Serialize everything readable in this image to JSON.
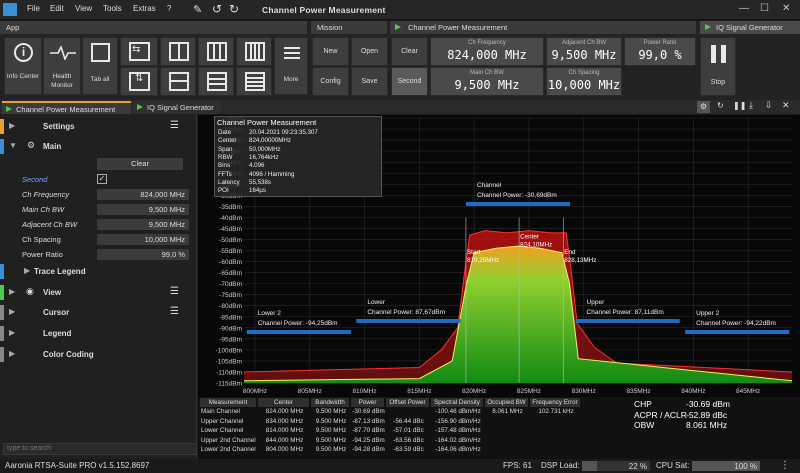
{
  "menu": {
    "file": "File",
    "edit": "Edit",
    "view": "View",
    "tools": "Tools",
    "extras": "Extras",
    "help": "?"
  },
  "window_title": "Channel Power Measurement",
  "groups": {
    "app": "App",
    "mission": "Mission",
    "channel": "Channel Power Measurement",
    "iq": "IQ Signal Generator"
  },
  "buttons": {
    "info_center": "Info Center",
    "health_monitor": "Health Monitor",
    "tab_all": "Tab all",
    "more": "More",
    "new": "New",
    "open": "Open",
    "config": "Config",
    "save": "Save",
    "clear": "Clear",
    "second": "Second",
    "stop": "Stop"
  },
  "fields": {
    "ch_frequency": {
      "label": "Ch Frequency",
      "value": "824,000 MHz"
    },
    "adjacent_ch_bw": {
      "label": "Adjacent Ch BW",
      "value": "9,500 MHz"
    },
    "power_ratio": {
      "label": "Power Ratio",
      "value": "99,0 %"
    },
    "main_ch_bw": {
      "label": "Main Ch BW",
      "value": "9,500 MHz"
    },
    "ch_spacing": {
      "label": "Ch Spacing",
      "value": "10,000 MHz"
    }
  },
  "tabs": {
    "channel": "Channel Power Measurement",
    "iq": "IQ Signal Generator"
  },
  "panel": {
    "settings": "Settings",
    "main": "Main",
    "clear": "Clear",
    "rows": [
      {
        "label": "Second",
        "value": ""
      },
      {
        "label": "Ch Frequency",
        "value": "824,000 MHz"
      },
      {
        "label": "Main Ch BW",
        "value": "9,500 MHz"
      },
      {
        "label": "Adjacent Ch BW",
        "value": "9,500 MHz"
      },
      {
        "label": "Ch Spacing",
        "value": "10,000 MHz"
      },
      {
        "label": "Power Ratio",
        "value": "99,0 %"
      }
    ],
    "trace_legend": "Trace Legend",
    "view": "View",
    "cursor": "Cursor",
    "legend": "Legend",
    "color_coding": "Color Coding",
    "search_placeholder": "type to search"
  },
  "chart_data": {
    "type": "line",
    "xlabel": "",
    "ylabel": "",
    "x_ticks": [
      "800MHz",
      "805MHz",
      "810MHz",
      "815MHz",
      "820MHz",
      "825MHz",
      "830MHz",
      "835MHz",
      "840MHz",
      "845MHz"
    ],
    "y_ticks": [
      "5dBm",
      "0dBm",
      "-5dBm",
      "-10dBm",
      "-15dBm",
      "-20dBm",
      "-25dBm",
      "-30dBm",
      "-35dBm",
      "-40dBm",
      "-45dBm",
      "-50dBm",
      "-55dBm",
      "-60dBm",
      "-65dBm",
      "-70dBm",
      "-75dBm",
      "-80dBm",
      "-85dBm",
      "-90dBm",
      "-95dBm",
      "-100dBm",
      "-105dBm",
      "-110dBm",
      "-115dBm"
    ],
    "ylim": [
      -115,
      5
    ],
    "xlim": [
      799,
      849
    ],
    "info_box": {
      "title": "Channel Power Measurement",
      "rows": [
        [
          "Date",
          "20.04.2021 09:23:35.307"
        ],
        [
          "Center",
          "824,00000MHz"
        ],
        [
          "Span",
          "50,000MHz"
        ],
        [
          "RBW",
          "16,764kHz"
        ],
        [
          "Bins",
          "4.096"
        ],
        [
          "FFTs",
          "4096 / Hamming"
        ],
        [
          "Latency",
          "55,538s"
        ],
        [
          "POI",
          "164µs"
        ]
      ]
    },
    "channels": [
      {
        "name": "Channel",
        "label": "Channel Power: -30,69dBm",
        "start": 819.25,
        "end": 828.75,
        "level": -33
      },
      {
        "name": "Lower",
        "label": "Channel Power: 87,67dBm",
        "start": 809.25,
        "end": 818.75,
        "level": -86
      },
      {
        "name": "Upper",
        "label": "Channel Power: 87,11dBm",
        "start": 829.25,
        "end": 838.75,
        "level": -86
      },
      {
        "name": "Lower 2",
        "label": "Channel Power: -94,25dBm",
        "start": 799.25,
        "end": 808.75,
        "level": -91
      },
      {
        "name": "Upper 2",
        "label": "Channel Power: -94,22dBm",
        "start": 839.25,
        "end": 848.75,
        "level": -91
      }
    ],
    "markers": [
      {
        "label": "Start",
        "freq": "819,25MHz",
        "x": 819.25
      },
      {
        "label": "Center",
        "freq": "824,10MHz",
        "x": 824.1
      },
      {
        "label": "End",
        "freq": "828,13MHz",
        "x": 828.13
      }
    ],
    "series": [
      {
        "points": [
          [
            799,
            -110
          ],
          [
            815,
            -108
          ],
          [
            817,
            -100
          ],
          [
            818.5,
            -90
          ],
          [
            819.2,
            -62
          ],
          [
            819.6,
            -48
          ],
          [
            821,
            -46
          ],
          [
            823,
            -47
          ],
          [
            825,
            -46
          ],
          [
            827,
            -47
          ],
          [
            828.4,
            -47
          ],
          [
            828.8,
            -62
          ],
          [
            829.4,
            -88
          ],
          [
            831,
            -99
          ],
          [
            833,
            -106
          ],
          [
            849,
            -110
          ]
        ]
      },
      {
        "points": [
          [
            799,
            -114
          ],
          [
            815,
            -113
          ],
          [
            818,
            -105
          ],
          [
            819.3,
            -70
          ],
          [
            820,
            -56
          ],
          [
            822,
            -54
          ],
          [
            824,
            -53
          ],
          [
            826,
            -54
          ],
          [
            828,
            -56
          ],
          [
            828.7,
            -70
          ],
          [
            829.5,
            -104
          ],
          [
            849,
            -114
          ]
        ]
      }
    ]
  },
  "table": {
    "headers": [
      "Measurement",
      "Center",
      "Bandwidth",
      "Power",
      "Offset Power",
      "Spectral Density",
      "Occupied BW",
      "Frequency Error"
    ],
    "rows": [
      [
        "Main Channel",
        "824.000 MHz",
        "9.500 MHz",
        "-30.69 dBm",
        "",
        "-100.46 dBm/Hz",
        "8.061 MHz",
        "102.731 kHz"
      ],
      [
        "Upper Channel",
        "834.000 MHz",
        "9.500 MHz",
        "-87.13 dBm",
        "-56.44 dBc",
        "-156.90 dBm/Hz",
        "",
        ""
      ],
      [
        "Lower Channel",
        "814.000 MHz",
        "9.500 MHz",
        "-87.70 dBm",
        "-57.01 dBc",
        "-157.48 dBm/Hz",
        "",
        ""
      ],
      [
        "Upper 2nd Channel",
        "844.000 MHz",
        "9.500 MHz",
        "-94.25 dBm",
        "-63.56 dBc",
        "-164.02 dBm/Hz",
        "",
        ""
      ],
      [
        "Lower 2nd Channel",
        "804.000 MHz",
        "9.500 MHz",
        "-94.28 dBm",
        "-63.59 dBc",
        "-164.06 dBm/Hz",
        "",
        ""
      ]
    ]
  },
  "summary": [
    [
      "CHP",
      "-30.69 dBm"
    ],
    [
      "ACPR / ACLR",
      "-52.89 dBc"
    ],
    [
      "OBW",
      "8.061 MHz"
    ]
  ],
  "status": {
    "version": "Aaronia RTSA-Suite PRO v1.5.152.8697",
    "fps": "FPS: 61",
    "dsp_load": "DSP Load:",
    "dsp_value": "22 %",
    "dsp_level": 0.22,
    "cpu_sat": "CPU Sat:",
    "cpu_value": "100 %",
    "cpu_level": 1.0
  }
}
